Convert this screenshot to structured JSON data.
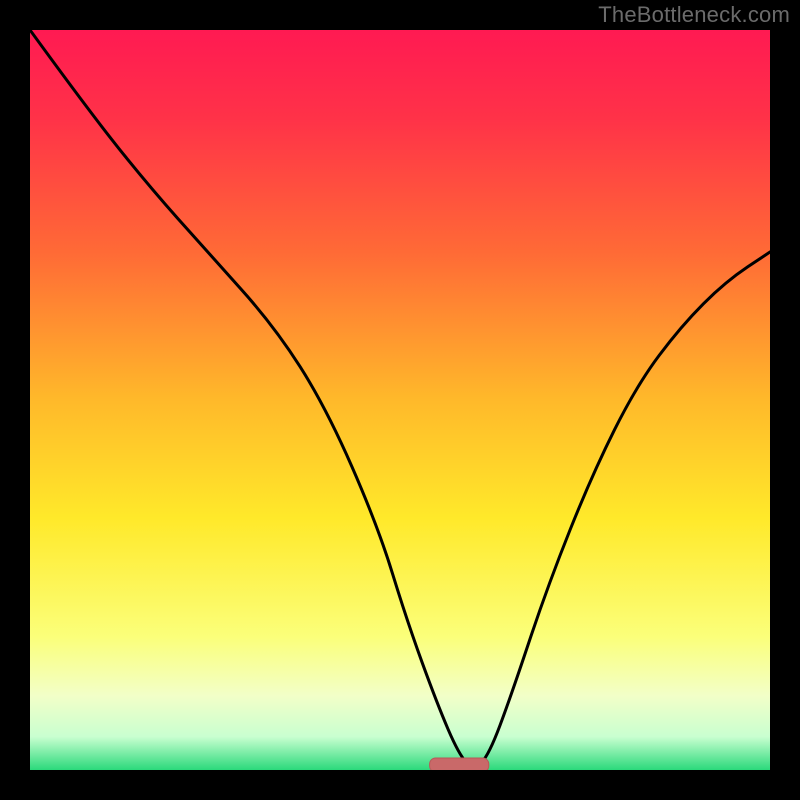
{
  "watermark": "TheBottleneck.com",
  "colors": {
    "bg_black": "#000000",
    "curve_stroke": "#000000",
    "marker_fill": "#c96969",
    "marker_stroke": "#b85858",
    "watermark_color": "#6b6b6b"
  },
  "chart_data": {
    "type": "line",
    "title": "",
    "xlabel": "",
    "ylabel": "",
    "xlim": [
      0,
      100
    ],
    "ylim": [
      0,
      100
    ],
    "annotations": [],
    "series": [
      {
        "name": "bottleneck-curve",
        "x": [
          0,
          8,
          16,
          24,
          33,
          40,
          47,
          51,
          55,
          58,
          60,
          62,
          65,
          70,
          76,
          82,
          88,
          94,
          100
        ],
        "y": [
          100,
          89,
          79,
          70,
          60,
          49,
          33,
          20,
          9,
          2,
          0,
          2,
          10,
          25,
          40,
          52,
          60,
          66,
          70
        ]
      }
    ],
    "marker": {
      "x": 58,
      "width": 8,
      "y": 0
    },
    "gradient_stops": [
      {
        "offset": 0.0,
        "color": "#ff1a52"
      },
      {
        "offset": 0.12,
        "color": "#ff3248"
      },
      {
        "offset": 0.3,
        "color": "#ff6a36"
      },
      {
        "offset": 0.5,
        "color": "#ffb92a"
      },
      {
        "offset": 0.66,
        "color": "#ffe92a"
      },
      {
        "offset": 0.82,
        "color": "#fbff7a"
      },
      {
        "offset": 0.9,
        "color": "#f2ffc8"
      },
      {
        "offset": 0.955,
        "color": "#c9ffd0"
      },
      {
        "offset": 1.0,
        "color": "#2bd97b"
      }
    ]
  }
}
